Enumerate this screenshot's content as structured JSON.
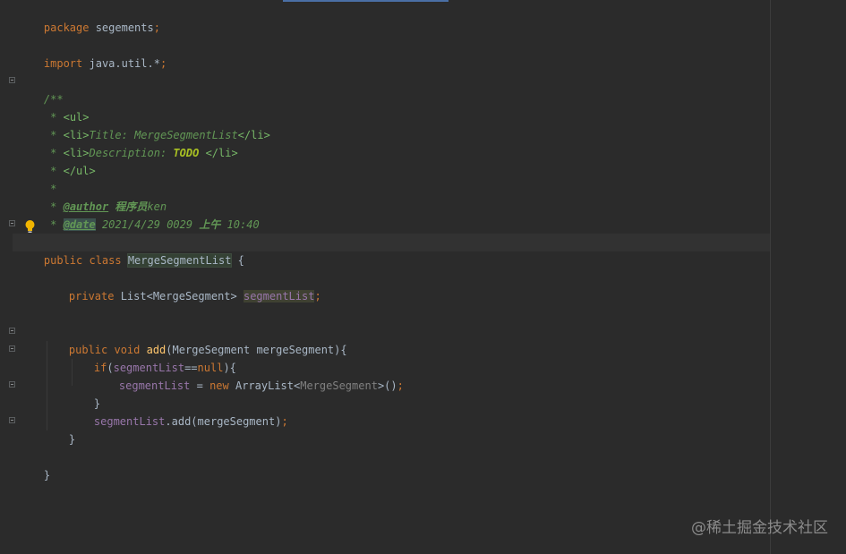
{
  "editor": {
    "lines": {
      "package_kw": "package",
      "package_name": " segements",
      "package_semicolon": ";",
      "import_kw": "import",
      "import_name": " java.util.*",
      "import_semicolon": ";",
      "doc_open": "/**",
      "doc_ul_prefix": " * ",
      "doc_ul": "<ul>",
      "doc_li1_prefix": " * ",
      "doc_li1_open": "<li>",
      "doc_li1_text": "Title: MergeSegmentList",
      "doc_li1_close": "</li>",
      "doc_li2_prefix": " * ",
      "doc_li2_open": "<li>",
      "doc_li2_text": "Description: ",
      "doc_li2_todo": "TODO",
      "doc_li2_space": " ",
      "doc_li2_close": "</li>",
      "doc_ul_close_prefix": " * ",
      "doc_ul_close": "</ul>",
      "doc_empty": " *",
      "doc_author_prefix": " * ",
      "doc_author_tag": "@author",
      "doc_author_space": " ",
      "doc_author_cjk": "程序员",
      "doc_author_name": "ken",
      "doc_date_prefix": " * ",
      "doc_date_tag": "@date",
      "doc_date_value": " 2021/4/29 0029 ",
      "doc_date_cjk": "上午",
      "doc_date_time": " 10:40",
      "class_kw": "public class ",
      "class_name": "MergeSegmentList",
      "class_brace": " {",
      "field_kw": "private ",
      "field_type": "List<MergeSegment> ",
      "field_name": "segmentList",
      "field_semicolon": ";",
      "method_kw": "public void ",
      "method_name": "add",
      "method_params": "(MergeSegment mergeSegment){",
      "if_kw": "if",
      "if_open": "(",
      "if_field": "segmentList",
      "if_eq": "==",
      "if_null": "null",
      "if_close": "){",
      "assign_field": "segmentList",
      "assign_eq": " = ",
      "assign_new": "new ",
      "assign_type": "ArrayList<",
      "assign_generic": "MergeSegment",
      "assign_end": ">()",
      "assign_semicolon": ";",
      "if_brace_close": "}",
      "call_field": "segmentList",
      "call_rest": ".add(mergeSegment)",
      "call_semicolon": ";",
      "method_brace_close": "}",
      "class_brace_close": "}"
    }
  },
  "watermark": "@稀土掘金技术社区",
  "colors": {
    "background": "#2b2b2b",
    "keyword": "#cc7832",
    "text": "#a9b7c6",
    "doc_comment": "#629755",
    "field": "#9876aa",
    "method": "#ffc66d"
  },
  "icons": [
    "fold-icon",
    "lightbulb-icon"
  ]
}
